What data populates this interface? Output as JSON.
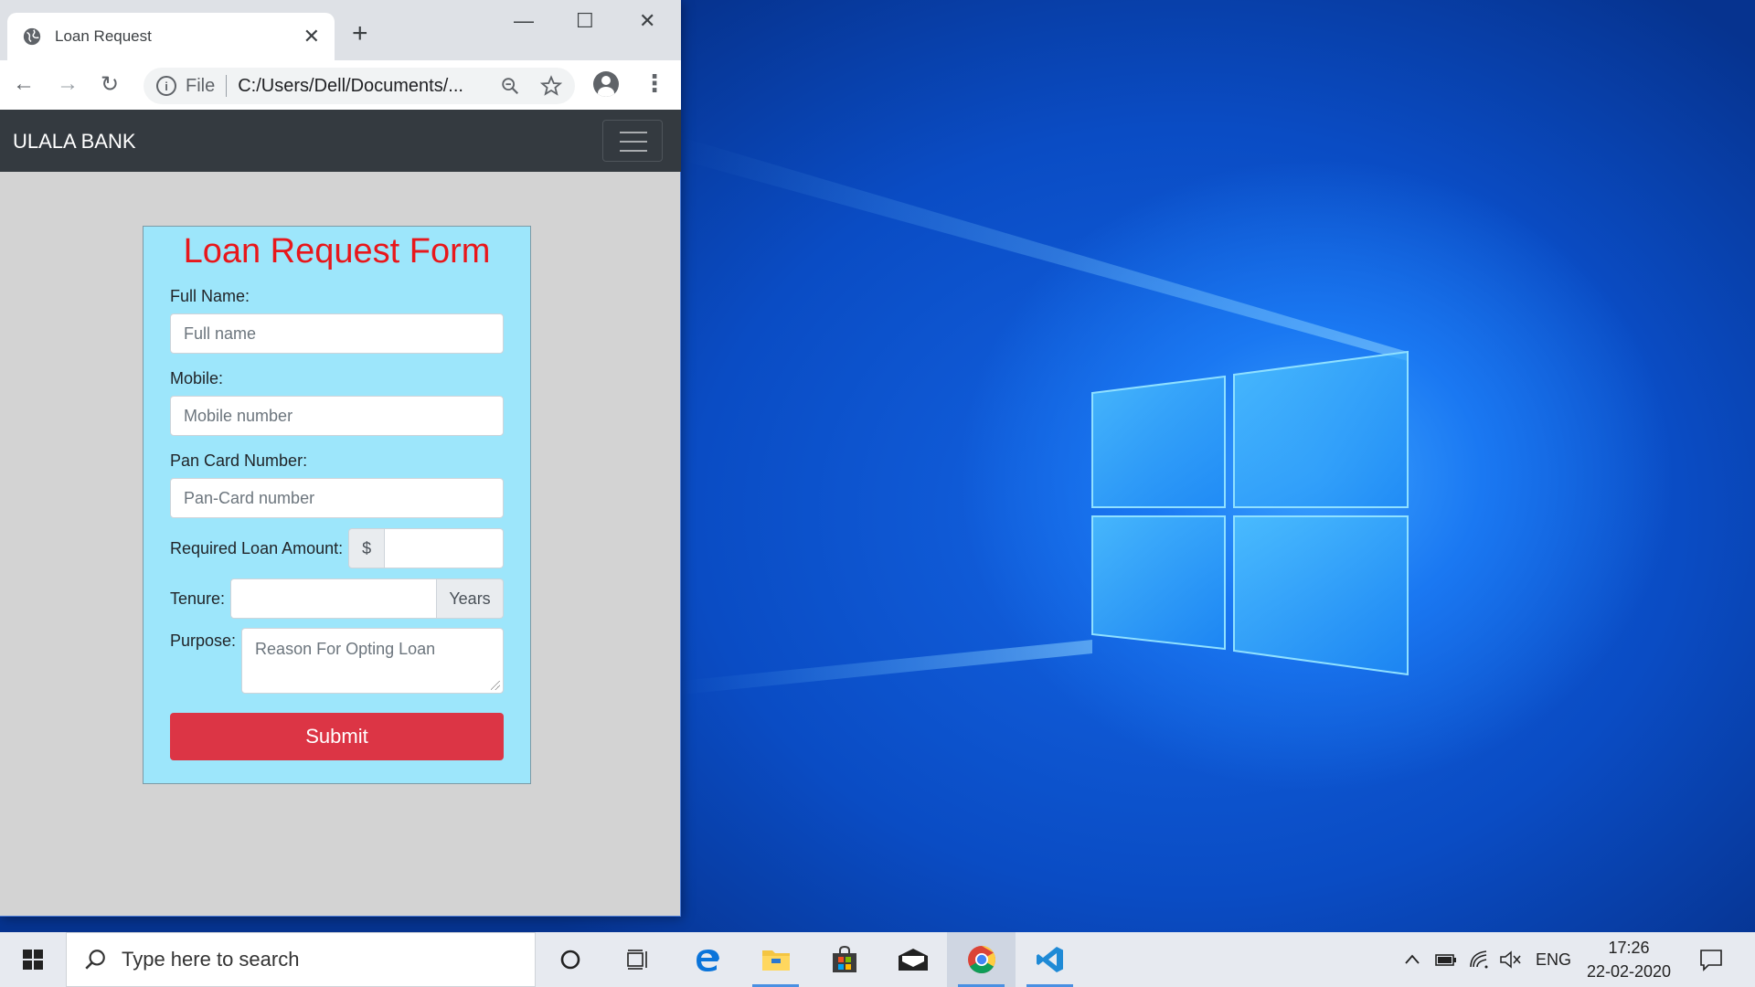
{
  "browser": {
    "tab_title": "Loan Request",
    "new_tab_glyph": "+",
    "tab_close_glyph": "✕",
    "scheme": "File",
    "url": "C:/Users/Dell/Documents/...",
    "window_controls": {
      "minimize": "—",
      "maximize": "☐",
      "close": "✕"
    },
    "nav": {
      "back": "←",
      "forward": "→",
      "reload": "↻"
    }
  },
  "site": {
    "brand": "ULALA BANK"
  },
  "form": {
    "title": "Loan Request Form",
    "full_name_label": "Full Name:",
    "full_name_placeholder": "Full name",
    "mobile_label": "Mobile:",
    "mobile_placeholder": "Mobile number",
    "pan_label": "Pan Card Number:",
    "pan_placeholder": "Pan-Card number",
    "amount_label": "Required Loan Amount:",
    "amount_prefix": "$",
    "tenure_label": "Tenure:",
    "tenure_suffix": "Years",
    "purpose_label": "Purpose:",
    "purpose_placeholder": "Reason For Opting Loan",
    "submit_label": "Submit"
  },
  "taskbar": {
    "search_placeholder": "Type here to search",
    "language": "ENG",
    "time": "17:26",
    "date": "22-02-2020"
  },
  "colors": {
    "form_bg": "#9de6fb",
    "title_red": "#e8171b",
    "submit_red": "#dc3545",
    "navbar_dark": "#343a40"
  }
}
